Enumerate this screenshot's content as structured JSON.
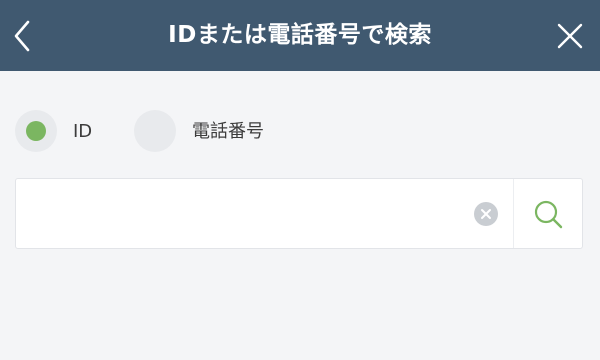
{
  "header": {
    "title": "IDまたは電話番号で検索",
    "back_icon": "chevron-left-icon",
    "close_icon": "close-icon"
  },
  "search_type": {
    "options": [
      {
        "label": "ID",
        "selected": true
      },
      {
        "label": "電話番号",
        "selected": false
      }
    ]
  },
  "search": {
    "value": "",
    "placeholder": "",
    "clear_icon": "clear-icon",
    "search_icon": "search-icon"
  },
  "colors": {
    "header_bg": "#405970",
    "page_bg": "#f4f5f7",
    "accent": "#7bb661",
    "radio_bg": "#e8eaed",
    "clear_icon": "#c9cdd2"
  }
}
